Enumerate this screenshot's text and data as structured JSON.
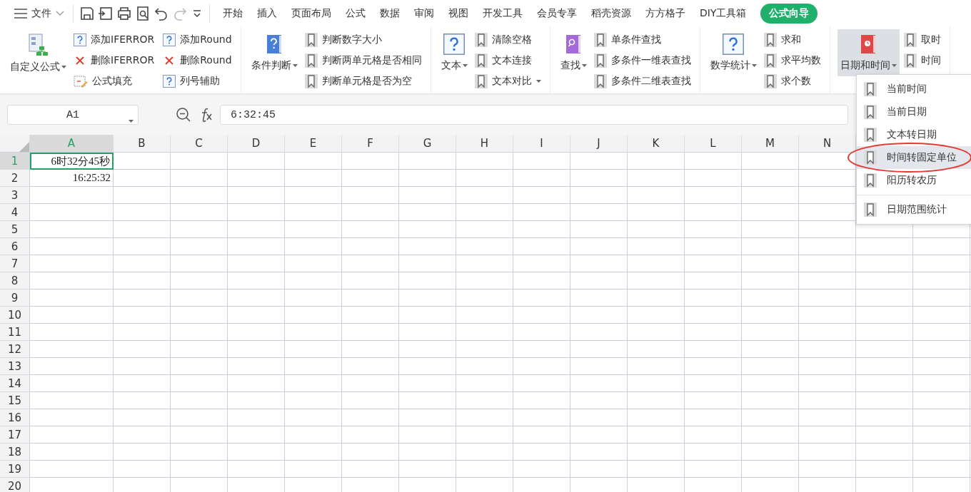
{
  "menu_bar": {
    "file_menu": "文件",
    "tabs": [
      {
        "label": "开始",
        "selected": false
      },
      {
        "label": "插入",
        "selected": false
      },
      {
        "label": "页面布局",
        "selected": false
      },
      {
        "label": "公式",
        "selected": false
      },
      {
        "label": "数据",
        "selected": false
      },
      {
        "label": "审阅",
        "selected": false
      },
      {
        "label": "视图",
        "selected": false
      },
      {
        "label": "开发工具",
        "selected": false
      },
      {
        "label": "会员专享",
        "selected": false
      },
      {
        "label": "稻壳资源",
        "selected": false
      },
      {
        "label": "方方格子",
        "selected": false
      },
      {
        "label": "DIY工具箱",
        "selected": false
      },
      {
        "label": "公式向导",
        "selected": true
      }
    ]
  },
  "ribbon": {
    "groups": [
      {
        "label": "自定义公式",
        "expanded": false,
        "items": [
          {
            "label": "添加IFERROR",
            "kind": "help",
            "dropdown": false
          },
          {
            "label": "删除IFERROR",
            "kind": "delete",
            "dropdown": false
          },
          {
            "label": "公式填充",
            "kind": "fill",
            "dropdown": false
          },
          {
            "label": "添加Round",
            "kind": "help",
            "dropdown": false
          },
          {
            "label": "删除Round",
            "kind": "delete",
            "dropdown": false
          },
          {
            "label": "列号辅助",
            "kind": "help",
            "dropdown": false
          }
        ]
      },
      {
        "label": "条件判断",
        "expanded": false,
        "items": [
          {
            "label": "判断数字大小",
            "kind": "bookmark",
            "dropdown": false
          },
          {
            "label": "判断两单元格是否相同",
            "kind": "bookmark",
            "dropdown": false
          },
          {
            "label": "判断单元格是否为空",
            "kind": "bookmark",
            "dropdown": false
          }
        ]
      },
      {
        "label": "文本",
        "expanded": false,
        "items": [
          {
            "label": "清除空格",
            "kind": "bookmark",
            "dropdown": false
          },
          {
            "label": "文本连接",
            "kind": "bookmark",
            "dropdown": false
          },
          {
            "label": "文本对比",
            "kind": "bookmark",
            "dropdown": true
          }
        ]
      },
      {
        "label": "查找",
        "expanded": false,
        "items": [
          {
            "label": "单条件查找",
            "kind": "bookmark",
            "dropdown": false
          },
          {
            "label": "多条件一维表查找",
            "kind": "bookmark",
            "dropdown": false
          },
          {
            "label": "多条件二维表查找",
            "kind": "bookmark",
            "dropdown": false
          }
        ]
      },
      {
        "label": "数学统计",
        "expanded": false,
        "items": [
          {
            "label": "求和",
            "kind": "bookmark",
            "dropdown": false
          },
          {
            "label": "求平均数",
            "kind": "bookmark",
            "dropdown": false
          },
          {
            "label": "求个数",
            "kind": "bookmark",
            "dropdown": false
          }
        ]
      },
      {
        "label": "日期和时间",
        "expanded": true,
        "items": [
          {
            "label": "取时",
            "kind": "bookmark",
            "dropdown": false
          },
          {
            "label": "时间",
            "kind": "bookmark",
            "dropdown": false
          }
        ]
      }
    ]
  },
  "formula_bar": {
    "name_box": "A1",
    "formula": "6:32:45"
  },
  "sheet": {
    "columns": [
      {
        "label": "A",
        "selected": true
      },
      {
        "label": "B",
        "selected": false
      },
      {
        "label": "C",
        "selected": false
      },
      {
        "label": "D",
        "selected": false
      },
      {
        "label": "E",
        "selected": false
      },
      {
        "label": "F",
        "selected": false
      },
      {
        "label": "G",
        "selected": false
      },
      {
        "label": "H",
        "selected": false
      },
      {
        "label": "I",
        "selected": false
      },
      {
        "label": "J",
        "selected": false
      },
      {
        "label": "K",
        "selected": false
      },
      {
        "label": "L",
        "selected": false
      },
      {
        "label": "M",
        "selected": false
      },
      {
        "label": "N",
        "selected": false
      }
    ],
    "rows": [
      {
        "label": "1",
        "selected": true,
        "cells": [
          "6时32分45秒"
        ]
      },
      {
        "label": "2",
        "selected": false,
        "cells": [
          "16:25:32"
        ]
      },
      {
        "label": "3",
        "selected": false
      },
      {
        "label": "4",
        "selected": false
      },
      {
        "label": "5",
        "selected": false
      },
      {
        "label": "6",
        "selected": false
      },
      {
        "label": "7",
        "selected": false
      },
      {
        "label": "8",
        "selected": false
      },
      {
        "label": "9",
        "selected": false
      },
      {
        "label": "10",
        "selected": false
      },
      {
        "label": "11",
        "selected": false
      },
      {
        "label": "12",
        "selected": false
      },
      {
        "label": "13",
        "selected": false
      },
      {
        "label": "14",
        "selected": false
      },
      {
        "label": "15",
        "selected": false
      },
      {
        "label": "16",
        "selected": false
      },
      {
        "label": "17",
        "selected": false
      },
      {
        "label": "18",
        "selected": false
      },
      {
        "label": "19",
        "selected": false
      },
      {
        "label": "20",
        "selected": false
      }
    ]
  },
  "dropdown": {
    "items": [
      {
        "kind": "item",
        "label": "当前时间",
        "selected": false
      },
      {
        "kind": "item",
        "label": "当前日期",
        "selected": false
      },
      {
        "kind": "item",
        "label": "文本转日期",
        "selected": false
      },
      {
        "kind": "item",
        "label": "时间转固定单位",
        "selected": true
      },
      {
        "kind": "item",
        "label": "阳历转农历",
        "selected": false
      },
      {
        "kind": "separator"
      },
      {
        "kind": "item",
        "label": "日期范围统计",
        "selected": false
      }
    ]
  }
}
